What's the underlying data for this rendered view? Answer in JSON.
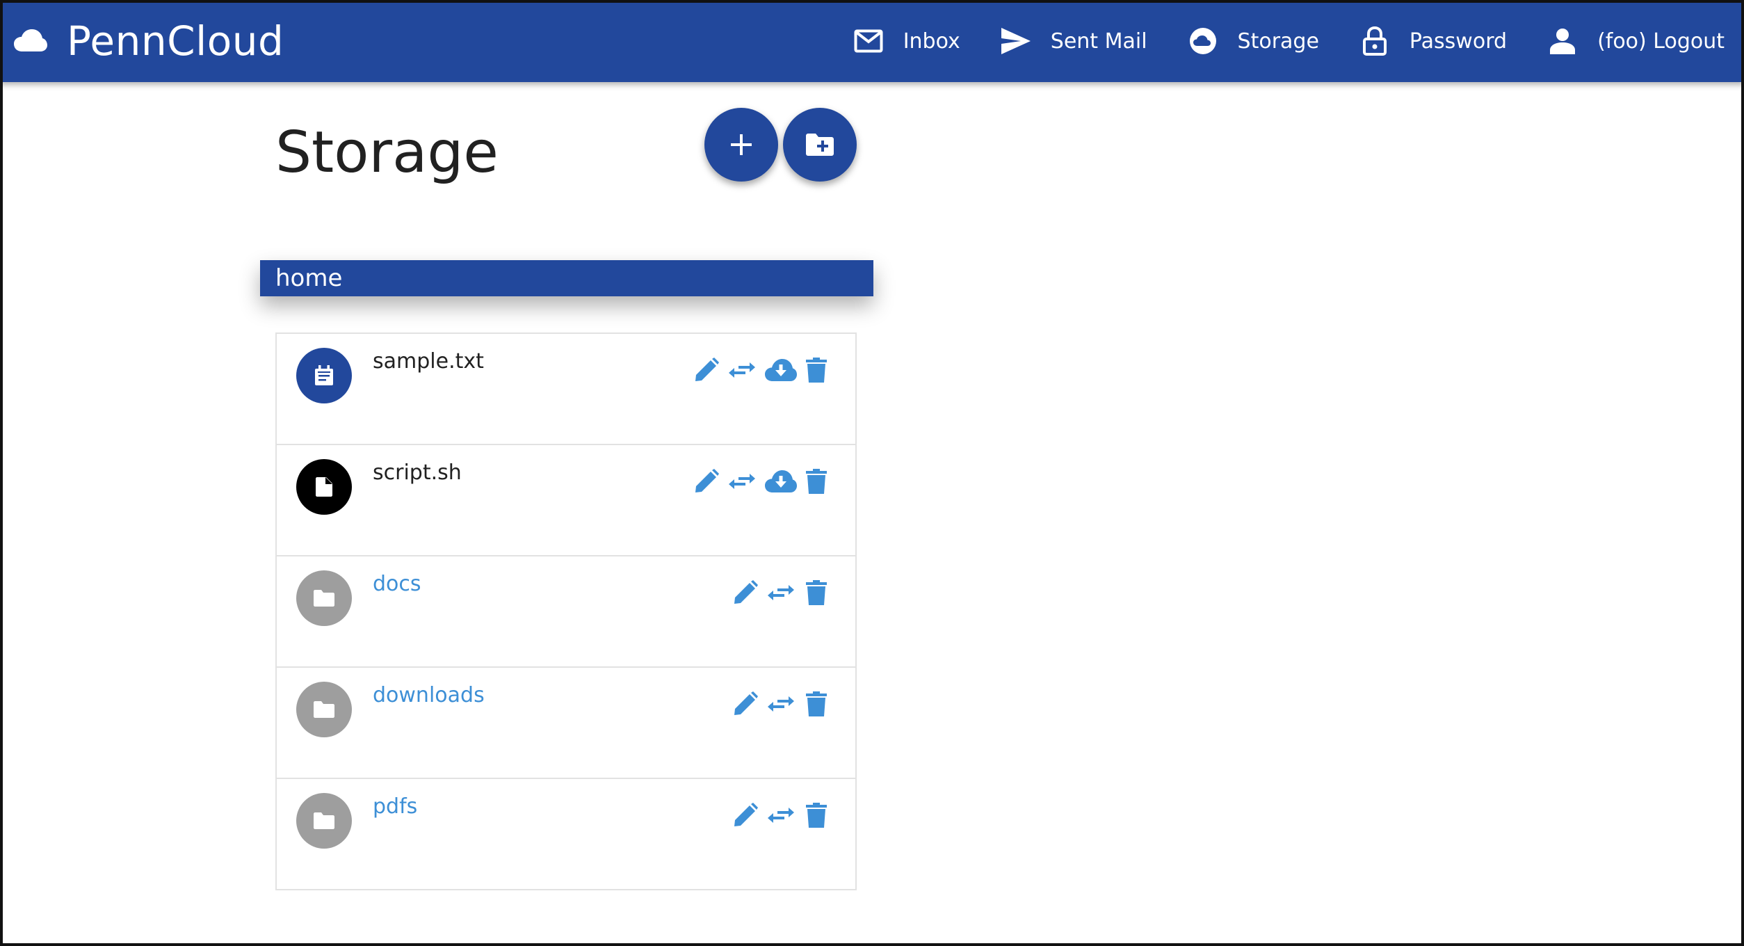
{
  "app": {
    "name": "PennCloud",
    "brand_icon": "cloud-icon"
  },
  "nav": {
    "inbox": "Inbox",
    "sent": "Sent Mail",
    "storage": "Storage",
    "password": "Password",
    "logout": "(foo) Logout"
  },
  "page": {
    "title": "Storage"
  },
  "fabs": {
    "add": "+",
    "new_folder_icon": "folder-plus-icon"
  },
  "breadcrumb": [
    "home"
  ],
  "items": [
    {
      "name": "sample.txt",
      "type": "file",
      "icon": "text-file-icon",
      "actions": [
        "edit",
        "move",
        "download",
        "delete"
      ]
    },
    {
      "name": "script.sh",
      "type": "file",
      "icon": "file-icon",
      "actions": [
        "edit",
        "move",
        "download",
        "delete"
      ]
    },
    {
      "name": "docs",
      "type": "folder",
      "icon": "folder-icon",
      "actions": [
        "edit",
        "move",
        "delete"
      ]
    },
    {
      "name": "downloads",
      "type": "folder",
      "icon": "folder-icon",
      "actions": [
        "edit",
        "move",
        "delete"
      ]
    },
    {
      "name": "pdfs",
      "type": "folder",
      "icon": "folder-icon",
      "actions": [
        "edit",
        "move",
        "delete"
      ]
    }
  ],
  "colors": {
    "primary": "#22489c",
    "link": "#3d8fd6",
    "folder_avatar": "#9e9e9e",
    "text": "#212121"
  }
}
